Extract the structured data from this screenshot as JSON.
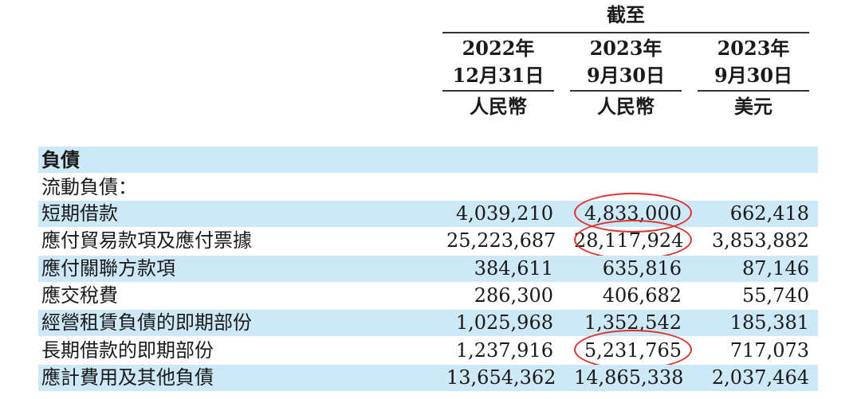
{
  "header": {
    "group_label": "截至",
    "columns": [
      {
        "year": "2022年",
        "date": "12月31日",
        "currency": "人民幣"
      },
      {
        "year": "2023年",
        "date": "9月30日",
        "currency": "人民幣"
      },
      {
        "year": "2023年",
        "date": "9月30日",
        "currency": "美元"
      }
    ]
  },
  "section": {
    "title": "負債",
    "subtitle": "流動負債："
  },
  "rows": [
    {
      "label": "短期借款",
      "values": [
        "4,039,210",
        "4,833,000",
        "662,418"
      ],
      "highlighted": [
        false,
        true,
        false
      ]
    },
    {
      "label": "應付貿易款項及應付票據",
      "values": [
        "25,223,687",
        "28,117,924",
        "3,853,882"
      ],
      "highlighted": [
        false,
        true,
        false
      ]
    },
    {
      "label": "應付關聯方款項",
      "values": [
        "384,611",
        "635,816",
        "87,146"
      ],
      "highlighted": [
        false,
        false,
        false
      ]
    },
    {
      "label": "應交稅費",
      "values": [
        "286,300",
        "406,682",
        "55,740"
      ],
      "highlighted": [
        false,
        false,
        false
      ]
    },
    {
      "label": "經營租賃負債的即期部份",
      "values": [
        "1,025,968",
        "1,352,542",
        "185,381"
      ],
      "highlighted": [
        false,
        false,
        false
      ]
    },
    {
      "label": "長期借款的即期部份",
      "values": [
        "1,237,916",
        "5,231,765",
        "717,073"
      ],
      "highlighted": [
        false,
        true,
        false
      ]
    },
    {
      "label": "應計費用及其他負債",
      "values": [
        "13,654,362",
        "14,865,338",
        "2,037,464"
      ],
      "highlighted": [
        false,
        false,
        false
      ]
    }
  ],
  "colors": {
    "band": "#cde8f6",
    "highlight_circle": "#e0322c",
    "text": "#1a1a1a"
  }
}
